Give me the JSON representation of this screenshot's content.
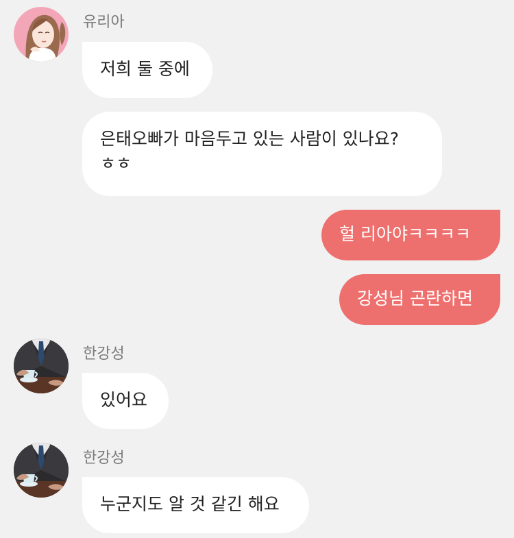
{
  "messages": [
    {
      "sender": "유리아",
      "text": "저희 둘 중에"
    },
    {
      "text_lines": [
        "은태오빠가 마음두고 있는 사람이 있나요?",
        "ㅎㅎ"
      ]
    },
    {
      "text": "헐 리아야ㅋㅋㅋㅋ"
    },
    {
      "text": "강성님 곤란하면"
    },
    {
      "sender": "한강성",
      "text": "있어요"
    },
    {
      "sender": "한강성",
      "text": "누군지도 알 것 같긴 해요"
    }
  ],
  "colors": {
    "background": "#f1f1f1",
    "incoming_bubble": "#ffffff",
    "outgoing_bubble": "#ee706e",
    "sender_name": "#7a7a7a"
  },
  "icons": {
    "avatar_yuria": "illustrated-woman-avatar",
    "avatar_hangangseong": "man-in-suit-with-coffee-avatar"
  }
}
